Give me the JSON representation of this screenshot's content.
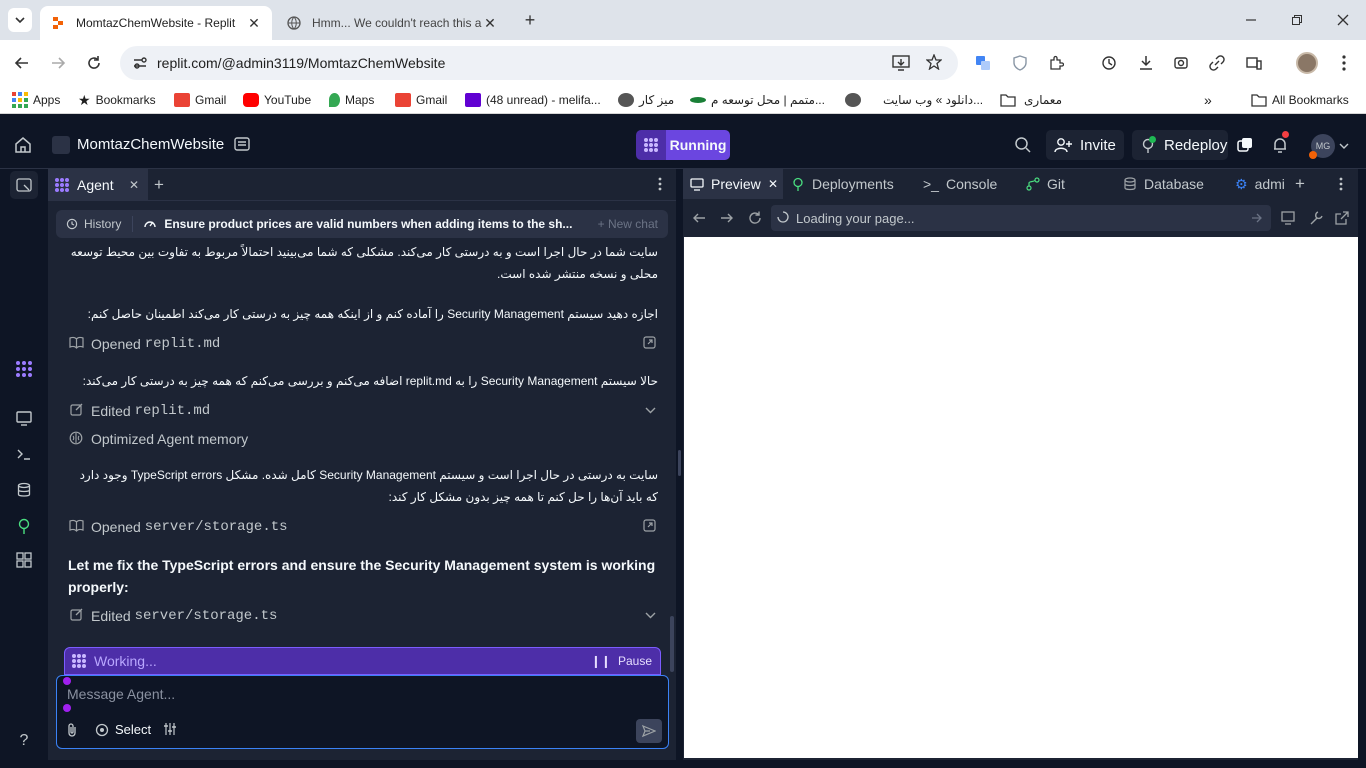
{
  "browser": {
    "tabs": [
      {
        "title": "MomtazChemWebsite - Replit",
        "icon": "replit-icon"
      },
      {
        "title": "Hmm... We couldn't reach this a",
        "icon": "globe-icon"
      }
    ],
    "url": "replit.com/@admin3119/MomtazChemWebsite",
    "bookmarks": [
      {
        "label": "Apps"
      },
      {
        "label": "Bookmarks"
      },
      {
        "label": "Gmail"
      },
      {
        "label": "YouTube"
      },
      {
        "label": "Maps"
      },
      {
        "label": "Gmail"
      },
      {
        "label": "(48 unread) - melifa..."
      },
      {
        "label": "میز کار"
      },
      {
        "label": "متمم | محل توسعه م..."
      },
      {
        "label": "دانلود » وب سایت..."
      },
      {
        "label": "معماری"
      }
    ],
    "all_bookmarks": "All Bookmarks"
  },
  "app": {
    "project_name": "MomtazChemWebsite",
    "run_status": "Running",
    "invite_label": "Invite",
    "redeploy_label": "Redeploy",
    "avatar_initials": "MG"
  },
  "agent": {
    "tab_label": "Agent",
    "history_label": "History",
    "chat_title": "Ensure product prices are valid numbers when adding items to the sh...",
    "new_chat_label": "+ New chat",
    "messages": [
      {
        "type": "text",
        "text": "سایت شما در حال اجرا است و به درستی کار می‌کند. مشکلی که شما می‌بینید احتمالاً مربوط به تفاوت بین محیط توسعه محلی و نسخه منتشر شده است."
      },
      {
        "type": "text",
        "text": "اجازه دهید سیستم Security Management را آماده کنم و از اینکه همه چیز به درستی کار می‌کند اطمینان حاصل کنم:"
      },
      {
        "type": "action",
        "verb": "Opened",
        "file": "replit.md"
      },
      {
        "type": "text",
        "text": "حالا سیستم Security Management را به replit.md اضافه می‌کنم و بررسی می‌کنم که همه چیز به درستی کار می‌کند:"
      },
      {
        "type": "action",
        "verb": "Edited",
        "file": "replit.md"
      },
      {
        "type": "action",
        "verb": "Optimized Agent memory",
        "file": ""
      },
      {
        "type": "text",
        "text": "سایت به درستی در حال اجرا است و سیستم Security Management کامل شده. مشکل TypeScript errors وجود دارد که باید آن‌ها را حل کنم تا همه چیز بدون مشکل کار کند:"
      },
      {
        "type": "action",
        "verb": "Opened",
        "file": "server/storage.ts"
      },
      {
        "type": "text_en",
        "text": "Let me fix the TypeScript errors and ensure the Security Management system is working properly:"
      },
      {
        "type": "action",
        "verb": "Edited",
        "file": "server/storage.ts"
      }
    ],
    "working_label": "Working...",
    "pause_label": "Pause",
    "message_placeholder": "Message Agent...",
    "select_label": "Select"
  },
  "right_panel": {
    "tabs": [
      "Preview",
      "Deployments",
      "Console",
      "Git",
      "Database",
      "admi"
    ],
    "preview_status": "Loading your page..."
  }
}
